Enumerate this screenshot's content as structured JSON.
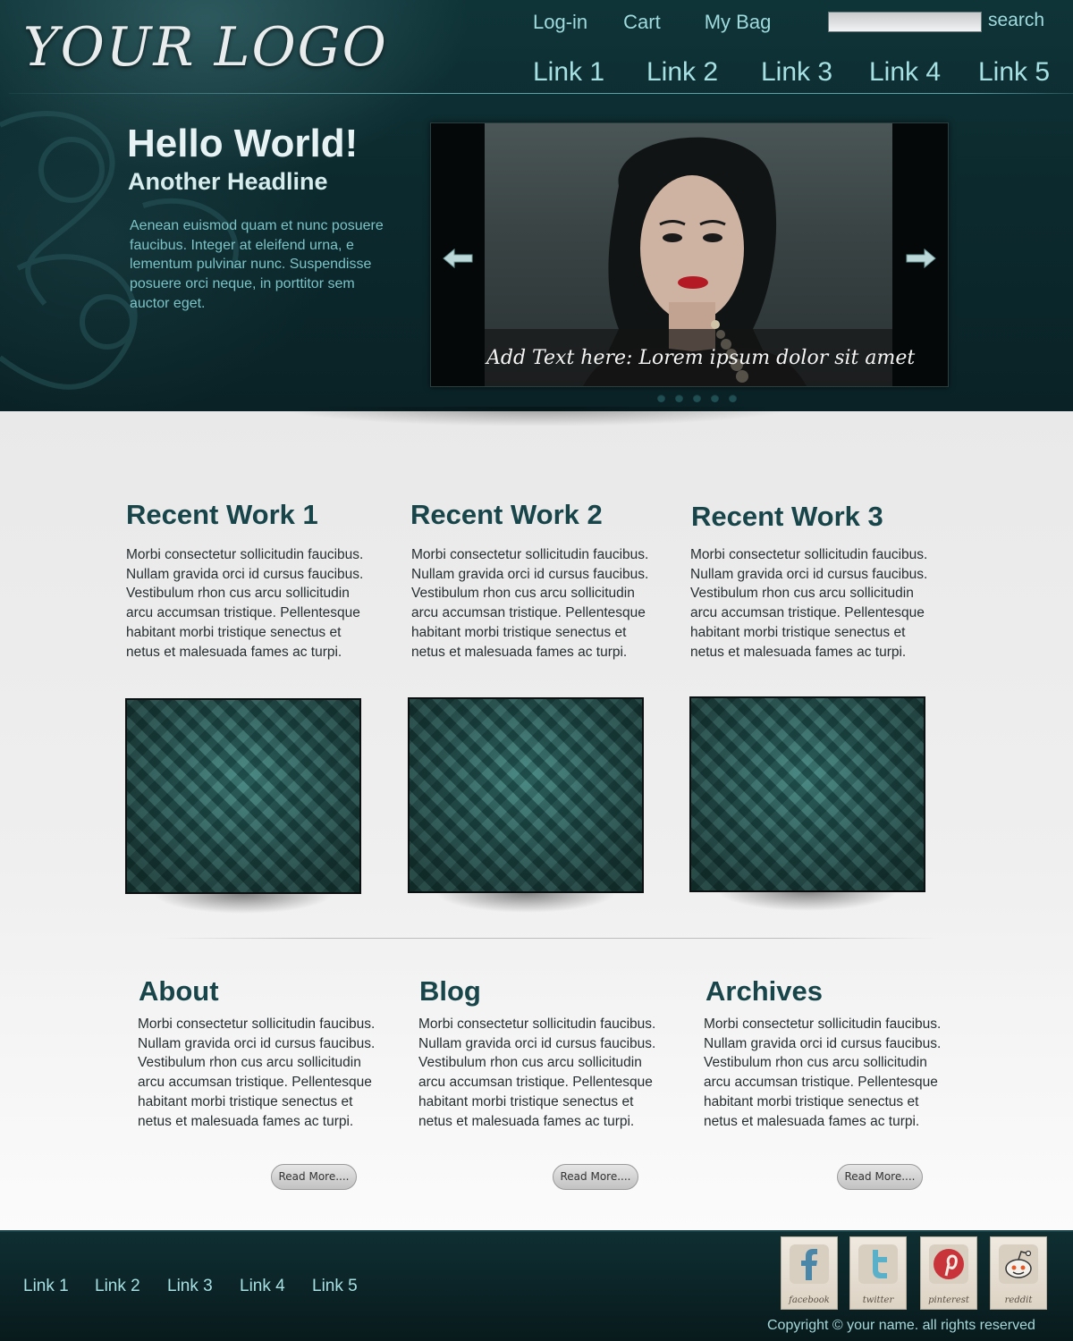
{
  "header": {
    "logo": "YOUR LOGO",
    "top_links": [
      "Log-in",
      "Cart",
      "My Bag"
    ],
    "search_label": "search",
    "nav_links": [
      "Link 1",
      "Link 2",
      "Link 3",
      "Link 4",
      "Link 5"
    ]
  },
  "hero": {
    "title": "Hello World!",
    "subtitle": "Another Headline",
    "text": "Aenean euismod quam et nunc posuere faucibus. Integer at eleifend urna, e lementum pulvinar nunc. Suspendisse posuere orci neque, in porttitor sem auctor eget.",
    "slider_caption": "Add Text here: Lorem ipsum dolor sit amet",
    "slider_dots": 5
  },
  "recent_work": [
    {
      "title": "Recent Work 1",
      "text": "Morbi consectetur sollicitudin faucibus. Nullam gravida orci id cursus faucibus. Vestibulum rhon cus arcu sollicitudin arcu accumsan tristique. Pellentesque habitant morbi tristique senectus et netus et malesuada fames ac turpi."
    },
    {
      "title": "Recent Work 2",
      "text": "Morbi consectetur sollicitudin faucibus. Nullam gravida orci id cursus faucibus. Vestibulum rhon cus arcu sollicitudin arcu accumsan tristique. Pellentesque habitant morbi tristique senectus et netus et malesuada fames ac turpi."
    },
    {
      "title": "Recent Work 3",
      "text": "Morbi consectetur sollicitudin faucibus. Nullam gravida orci id cursus faucibus. Vestibulum rhon cus arcu sollicitudin arcu accumsan tristique. Pellentesque habitant morbi tristique senectus et netus et malesuada fames ac turpi."
    }
  ],
  "sections": [
    {
      "title": "About",
      "text": "Morbi consectetur sollicitudin faucibus. Nullam gravida orci id cursus faucibus. Vestibulum rhon cus arcu sollicitudin arcu accumsan tristique. Pellentesque habitant morbi tristique senectus et netus et malesuada fames ac turpi.",
      "button": "Read More...."
    },
    {
      "title": "Blog",
      "text": "Morbi consectetur sollicitudin faucibus. Nullam gravida orci id cursus faucibus. Vestibulum rhon cus arcu sollicitudin arcu accumsan tristique. Pellentesque habitant morbi tristique senectus et netus et malesuada fames ac turpi.",
      "button": "Read More...."
    },
    {
      "title": "Archives",
      "text": "Morbi consectetur sollicitudin faucibus. Nullam gravida orci id cursus faucibus. Vestibulum rhon cus arcu sollicitudin arcu accumsan tristique. Pellentesque habitant morbi tristique senectus et netus et malesuada fames ac turpi.",
      "button": "Read More...."
    }
  ],
  "footer": {
    "links": [
      "Link 1",
      "Link 2",
      "Link 3",
      "Link 4",
      "Link 5"
    ],
    "social": [
      {
        "label": "facebook",
        "icon": "facebook-icon",
        "color": "#4a86a8"
      },
      {
        "label": "twitter",
        "icon": "twitter-icon",
        "color": "#5ab0c8"
      },
      {
        "label": "pinterest",
        "icon": "pinterest-icon",
        "color": "#c8343a"
      },
      {
        "label": "reddit",
        "icon": "reddit-icon",
        "color": "#e05a2a"
      }
    ],
    "copyright": "Copyright © your name. all rights reserved"
  },
  "colors": {
    "header_bg": "#0c2b2f",
    "accent_text": "#9fdadd",
    "heading": "#17454a"
  }
}
